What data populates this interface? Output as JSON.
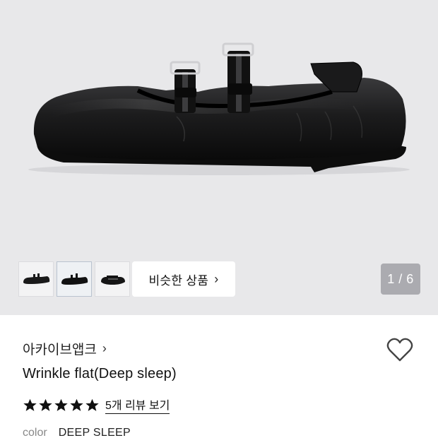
{
  "gallery": {
    "thumbnails": [
      {
        "icon": "shoe-side-thumbnail",
        "active": false
      },
      {
        "icon": "shoe-side-thumbnail",
        "active": true
      },
      {
        "icon": "shoe-top-thumbnail",
        "active": false
      }
    ],
    "similar_label": "비슷한 상품",
    "similar_chevron": "›",
    "counter": "1 / 6"
  },
  "product": {
    "brand": "아카이브앱크",
    "brand_chevron": "›",
    "title": "Wrinkle flat(Deep sleep)",
    "rating_stars": 5,
    "review_link": "5개 리뷰 보기",
    "color_label": "color",
    "color_value": "DEEP SLEEP"
  },
  "colors": {
    "hero_bg": "#e8e8ea",
    "star": "#111111",
    "counter_bg": "#a0a0a6"
  }
}
